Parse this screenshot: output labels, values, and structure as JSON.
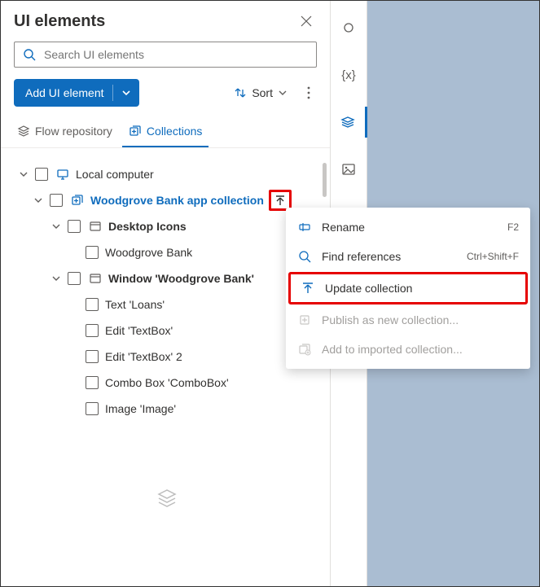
{
  "header": {
    "title": "UI elements"
  },
  "search": {
    "placeholder": "Search UI elements"
  },
  "toolbar": {
    "add_label": "Add UI element",
    "sort_label": "Sort"
  },
  "tabs": {
    "flow_repo": "Flow repository",
    "collections": "Collections"
  },
  "tree": {
    "root": {
      "label": "Local computer"
    },
    "collection": {
      "label": "Woodgrove Bank app collection"
    },
    "group1": {
      "label": "Desktop Icons"
    },
    "g1_items": {
      "0": "Woodgrove Bank"
    },
    "group2": {
      "label": "Window 'Woodgrove Bank'"
    },
    "g2_items": {
      "0": "Text 'Loans'",
      "1": "Edit 'TextBox'",
      "2": "Edit 'TextBox' 2",
      "3": "Combo Box 'ComboBox'",
      "4": "Image 'Image'"
    }
  },
  "context_menu": {
    "rename": {
      "label": "Rename",
      "shortcut": "F2"
    },
    "find": {
      "label": "Find references",
      "shortcut": "Ctrl+Shift+F"
    },
    "update": {
      "label": "Update collection"
    },
    "publish": {
      "label": "Publish as new collection..."
    },
    "add_import": {
      "label": "Add to imported collection..."
    }
  }
}
